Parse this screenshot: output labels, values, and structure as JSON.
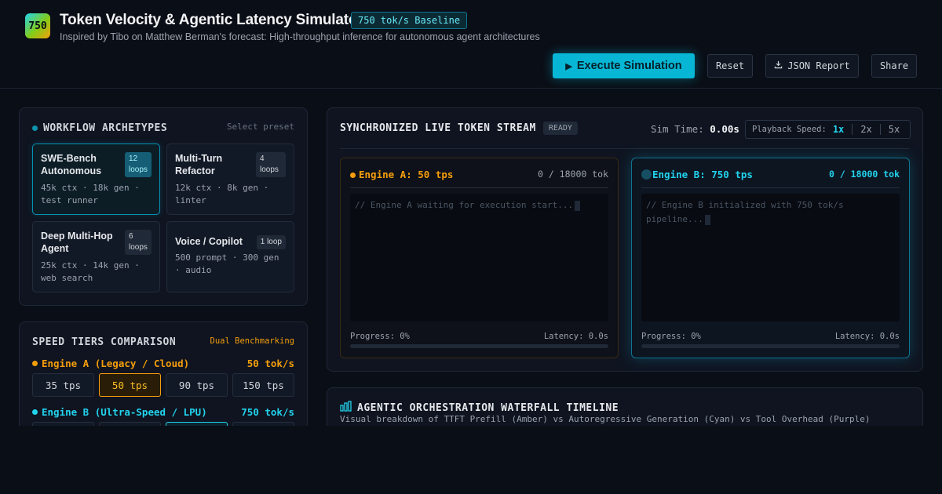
{
  "header": {
    "logo_text": "750",
    "title": "Token Velocity & Agentic Latency Simulator",
    "badge": "750 tok/s Baseline",
    "subtitle": "Inspired by Tibo on Matthew Berman's forecast: High-throughput inference for autonomous agent architectures",
    "buttons": {
      "execute": "Execute Simulation",
      "reset": "Reset",
      "json": "JSON Report",
      "share": "Share"
    }
  },
  "workflows": {
    "title": "WORKFLOW ARCHETYPES",
    "hint": "Select preset",
    "cards": [
      {
        "name": "SWE-Bench Autonomous",
        "badge": "12 loops",
        "desc": "45k ctx · 18k gen · test runner",
        "active": true
      },
      {
        "name": "Multi-Turn Refactor",
        "badge": "4 loops",
        "desc": "12k ctx · 8k gen · linter",
        "active": false
      },
      {
        "name": "Deep Multi-Hop Agent",
        "badge": "6 loops",
        "desc": "25k ctx · 14k gen · web search",
        "active": false
      },
      {
        "name": "Voice / Copilot",
        "badge": "1 loop",
        "desc": "500 prompt · 300 gen · audio",
        "active": false
      }
    ]
  },
  "tiers": {
    "title": "SPEED TIERS COMPARISON",
    "tag": "Dual Benchmarking",
    "engine_a": {
      "label": "Engine A (Legacy / Cloud)",
      "value": "50 tok/s",
      "options": [
        "35 tps",
        "50 tps",
        "90 tps",
        "150 tps"
      ],
      "selected": 1
    },
    "engine_b": {
      "label": "Engine B (Ultra-Speed / LPU)",
      "value": "750 tok/s",
      "selected": 2
    }
  },
  "stream": {
    "title": "SYNCHRONIZED LIVE TOKEN STREAM",
    "status": "READY",
    "sim_time_label": "Sim Time:",
    "sim_time_value": "0.00s",
    "playback_label": "Playback Speed:",
    "speeds": [
      "1x",
      "2x",
      "5x"
    ],
    "engine_a": {
      "name": "Engine A: 50 tps",
      "count": "0 / 18000 tok",
      "log": "// Engine A waiting for execution start...",
      "progress": "Progress: 0%",
      "latency": "Latency: 0.0s",
      "progress_value": 0
    },
    "engine_b": {
      "name": "Engine B: 750 tps",
      "count": "0 / 18000 tok",
      "log": "// Engine B initialized with 750 tok/s pipeline...",
      "progress": "Progress: 0%",
      "latency": "Latency: 0.0s",
      "progress_value": 0
    }
  },
  "waterfall": {
    "title": "AGENTIC ORCHESTRATION WATERFALL TIMELINE",
    "subtitle": "Visual breakdown of TTFT Prefill (Amber) vs Autoregressive Generation (Cyan) vs Tool Overhead (Purple)"
  },
  "colors": {
    "accent_cyan": "#22d3ee",
    "accent_amber": "#f59e0b",
    "background": "#0a0e16"
  }
}
